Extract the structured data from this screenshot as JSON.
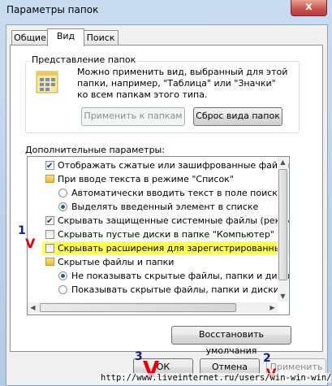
{
  "window": {
    "title": "Параметры папок",
    "close_glyph": "x"
  },
  "tabs": [
    {
      "label": "Общие",
      "active": false
    },
    {
      "label": "Вид",
      "active": true
    },
    {
      "label": "Поиск",
      "active": false
    }
  ],
  "folder_view": {
    "group_label": "Представление папок",
    "description_line1": "Можно применить вид, выбранный для этой",
    "description_line2": "папки, например, \"Таблица\" или \"Значки\"",
    "description_line3": "ко всем папкам этого типа.",
    "apply_button": "Применить к папкам",
    "reset_button": "Сброс вида папок"
  },
  "advanced": {
    "label": "Дополнительные параметры:",
    "items": [
      {
        "kind": "checkbox",
        "checked": true,
        "text": "Отображать сжатые или зашифрованные файлы NTI"
      },
      {
        "kind": "folder",
        "text": "При вводе текста в режиме \"Список\""
      },
      {
        "kind": "radio",
        "checked": false,
        "text": "Автоматически вводить текст в поле поиска"
      },
      {
        "kind": "radio",
        "checked": true,
        "text": "Выделять введенный элемент в списке"
      },
      {
        "kind": "checkbox",
        "checked": true,
        "text": "Скрывать защищенные системные файлы (рекомен,"
      },
      {
        "kind": "checkbox",
        "checked": false,
        "text": "Скрывать пустые диски в папке \"Компьютер\""
      },
      {
        "kind": "checkbox",
        "checked": false,
        "text": "Скрывать расширения для зарегистрированных типо",
        "highlight": true
      },
      {
        "kind": "folder",
        "text": "Скрытые файлы и папки"
      },
      {
        "kind": "radio",
        "checked": true,
        "text": "Не показывать скрытые файлы, папки и диски"
      },
      {
        "kind": "radio",
        "checked": false,
        "text": "Показывать скрытые файлы, папки и диски"
      }
    ],
    "restore_button": "Восстановить умолчания"
  },
  "footer": {
    "ok": "ОК",
    "cancel": "Отмена",
    "apply": "Применить"
  },
  "annotations": {
    "step1": "1",
    "mark1": "V",
    "step2": "2",
    "mark2": "V",
    "step3": "3",
    "mark3": "V"
  },
  "watermark": "http://www.liveinternet.ru/users/win-win-win/",
  "colors": {
    "highlight": "#ffff55",
    "annotation_red": "#e4000f",
    "annotation_navy": "#1b1d8c"
  }
}
